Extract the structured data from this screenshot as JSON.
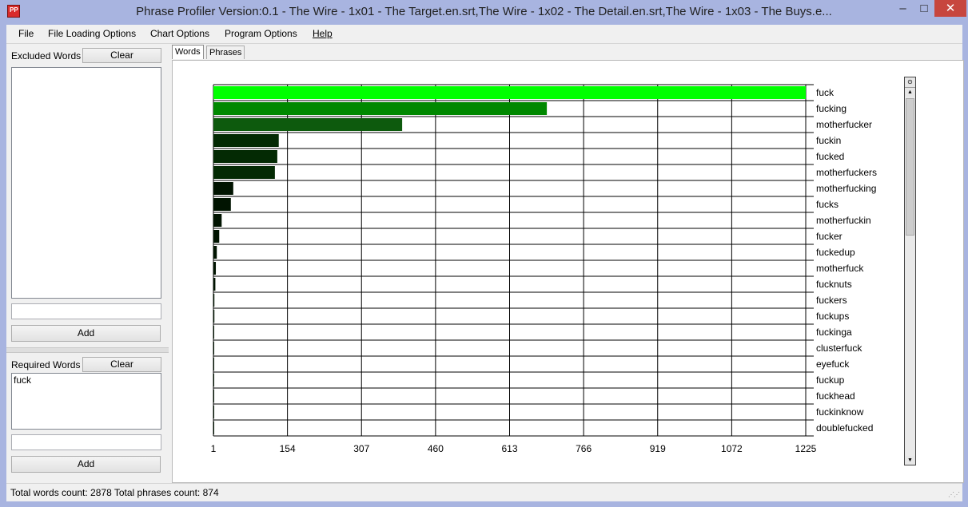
{
  "window": {
    "title": "Phrase Profiler Version:0.1 - The Wire - 1x01 - The Target.en.srt,The Wire - 1x02 - The Detail.en.srt,The Wire - 1x03 - The Buys.e...",
    "app_icon_text": "PP"
  },
  "window_controls": {
    "minimize": "–",
    "maximize": "□",
    "close": "✕"
  },
  "menu": {
    "items": [
      "File",
      "File Loading Options",
      "Chart Options",
      "Program Options",
      "Help"
    ]
  },
  "left": {
    "excluded": {
      "label": "Excluded Words",
      "clear": "Clear",
      "items": [],
      "input_value": "",
      "add": "Add"
    },
    "required": {
      "label": "Required Words",
      "clear": "Clear",
      "items": [
        "fuck"
      ],
      "input_value": "",
      "add": "Add"
    }
  },
  "tabs": [
    {
      "label": "Words",
      "active": true
    },
    {
      "label": "Phrases",
      "active": false
    }
  ],
  "scrollbar": {
    "top": "⊙",
    "up": "▲",
    "down": "▼"
  },
  "status": {
    "text": "Total words count:  2878  Total phrases count:  874",
    "grip": "⋰⋰"
  },
  "chart_data": {
    "type": "bar",
    "orientation": "horizontal",
    "categories": [
      "fuck",
      "fucking",
      "motherfucker",
      "fuckin",
      "fucked",
      "motherfuckers",
      "motherfucking",
      "fucks",
      "motherfuckin",
      "fucker",
      "fuckedup",
      "motherfuck",
      "fucknuts",
      "fuckers",
      "fuckups",
      "fuckinga",
      "clusterfuck",
      "eyefuck",
      "fuckup",
      "fuckhead",
      "fuckinknow",
      "doublefucked"
    ],
    "values": [
      1225,
      690,
      391,
      136,
      133,
      128,
      42,
      37,
      18,
      13,
      8,
      6,
      5,
      3,
      3,
      2,
      2,
      2,
      2,
      2,
      2,
      1
    ],
    "bar_colors": [
      "#00ff00",
      "#008800",
      "#0d5a0d",
      "#032a03",
      "#032a03",
      "#032a03",
      "#011401",
      "#011401",
      "#011401",
      "#011401",
      "#011401",
      "#011401",
      "#011401",
      "#011401",
      "#011401",
      "#011401",
      "#011401",
      "#011401",
      "#011401",
      "#011401",
      "#011401",
      "#011401"
    ],
    "xticks": [
      "1",
      "154",
      "307",
      "460",
      "613",
      "766",
      "919",
      "1072",
      "1225"
    ],
    "xlim": [
      1,
      1225
    ],
    "grid": true,
    "category_labels_position": "right"
  }
}
